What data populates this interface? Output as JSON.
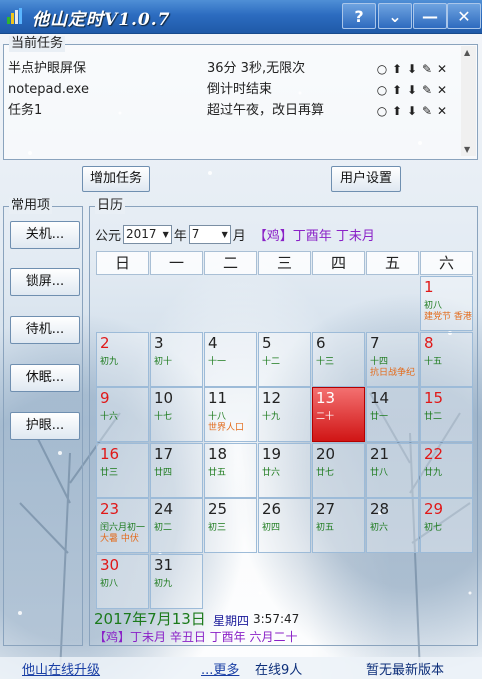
{
  "window": {
    "title": "他山定时V1.0.7"
  },
  "titlebar": {
    "help_label": "?",
    "menu_label": "⌄",
    "minimize_label": "—",
    "close_label": "✕"
  },
  "tasks": {
    "group_label": "当前任务",
    "rows": [
      {
        "name": "半点护眼屏保",
        "status": "36分 3秒,无限次"
      },
      {
        "name": "notepad.exe",
        "status": "倒计时结束"
      },
      {
        "name": "任务1",
        "status": "超过午夜，改日再算"
      }
    ]
  },
  "buttons": {
    "add_task": "增加任务",
    "user_settings": "用户设置"
  },
  "common": {
    "group_label": "常用项",
    "items": [
      "关机...",
      "锁屏...",
      "待机...",
      "休眠...",
      "护眼..."
    ]
  },
  "calendar": {
    "group_label": "日历",
    "era_label": "公元",
    "year": "2017",
    "year_suffix": "年",
    "month": "7",
    "month_suffix": "月",
    "ganzhi": "【鸡】丁酉年 丁未月",
    "weekdays": [
      "日",
      "一",
      "二",
      "三",
      "四",
      "五",
      "六"
    ],
    "days": [
      {
        "num": "1",
        "lunar": "初八",
        "fest": "建党节 香港",
        "red": true
      },
      {
        "num": "2",
        "lunar": "初九",
        "fest": "",
        "red": true
      },
      {
        "num": "3",
        "lunar": "初十",
        "fest": "",
        "red": false
      },
      {
        "num": "4",
        "lunar": "十一",
        "fest": "",
        "red": false
      },
      {
        "num": "5",
        "lunar": "十二",
        "fest": "",
        "red": false
      },
      {
        "num": "6",
        "lunar": "十三",
        "fest": "",
        "red": false
      },
      {
        "num": "7",
        "lunar": "十四",
        "fest": "抗日战争纪",
        "red": false
      },
      {
        "num": "8",
        "lunar": "十五",
        "fest": "",
        "red": true
      },
      {
        "num": "9",
        "lunar": "十六",
        "fest": "",
        "red": true
      },
      {
        "num": "10",
        "lunar": "十七",
        "fest": "",
        "red": false
      },
      {
        "num": "11",
        "lunar": "十八",
        "fest": "世界人口",
        "red": false
      },
      {
        "num": "12",
        "lunar": "十九",
        "fest": "",
        "red": false
      },
      {
        "num": "13",
        "lunar": "二十",
        "fest": "",
        "red": false,
        "today": true
      },
      {
        "num": "14",
        "lunar": "廿一",
        "fest": "",
        "red": false
      },
      {
        "num": "15",
        "lunar": "廿二",
        "fest": "",
        "red": true
      },
      {
        "num": "16",
        "lunar": "廿三",
        "fest": "",
        "red": true
      },
      {
        "num": "17",
        "lunar": "廿四",
        "fest": "",
        "red": false
      },
      {
        "num": "18",
        "lunar": "廿五",
        "fest": "",
        "red": false
      },
      {
        "num": "19",
        "lunar": "廿六",
        "fest": "",
        "red": false
      },
      {
        "num": "20",
        "lunar": "廿七",
        "fest": "",
        "red": false
      },
      {
        "num": "21",
        "lunar": "廿八",
        "fest": "",
        "red": false
      },
      {
        "num": "22",
        "lunar": "廿九",
        "fest": "",
        "red": true
      },
      {
        "num": "23",
        "lunar": "闰六月初一",
        "fest": "大暑 中伏",
        "red": true
      },
      {
        "num": "24",
        "lunar": "初二",
        "fest": "",
        "red": false
      },
      {
        "num": "25",
        "lunar": "初三",
        "fest": "",
        "red": false
      },
      {
        "num": "26",
        "lunar": "初四",
        "fest": "",
        "red": false
      },
      {
        "num": "27",
        "lunar": "初五",
        "fest": "",
        "red": false
      },
      {
        "num": "28",
        "lunar": "初六",
        "fest": "",
        "red": false
      },
      {
        "num": "29",
        "lunar": "初七",
        "fest": "",
        "red": true
      },
      {
        "num": "30",
        "lunar": "初八",
        "fest": "",
        "red": true
      },
      {
        "num": "31",
        "lunar": "初九",
        "fest": "",
        "red": false
      }
    ],
    "first_weekday": 6,
    "today_big": "2017年7月13日",
    "today_weekday": "星期四",
    "clock": "3:57:47",
    "today_lunar": "【鸡】丁未月 辛丑日 丁酉年 六月二十"
  },
  "status": {
    "upgrade_link": "他山在线升级",
    "more_link": "...更多",
    "online": "在线9人",
    "version_note": "暂无最新版本"
  },
  "colors": {
    "accent": "#2c6cc0",
    "today": "#d01515",
    "lunar": "#1b7a1b",
    "ganzhi": "#8a21c7"
  }
}
